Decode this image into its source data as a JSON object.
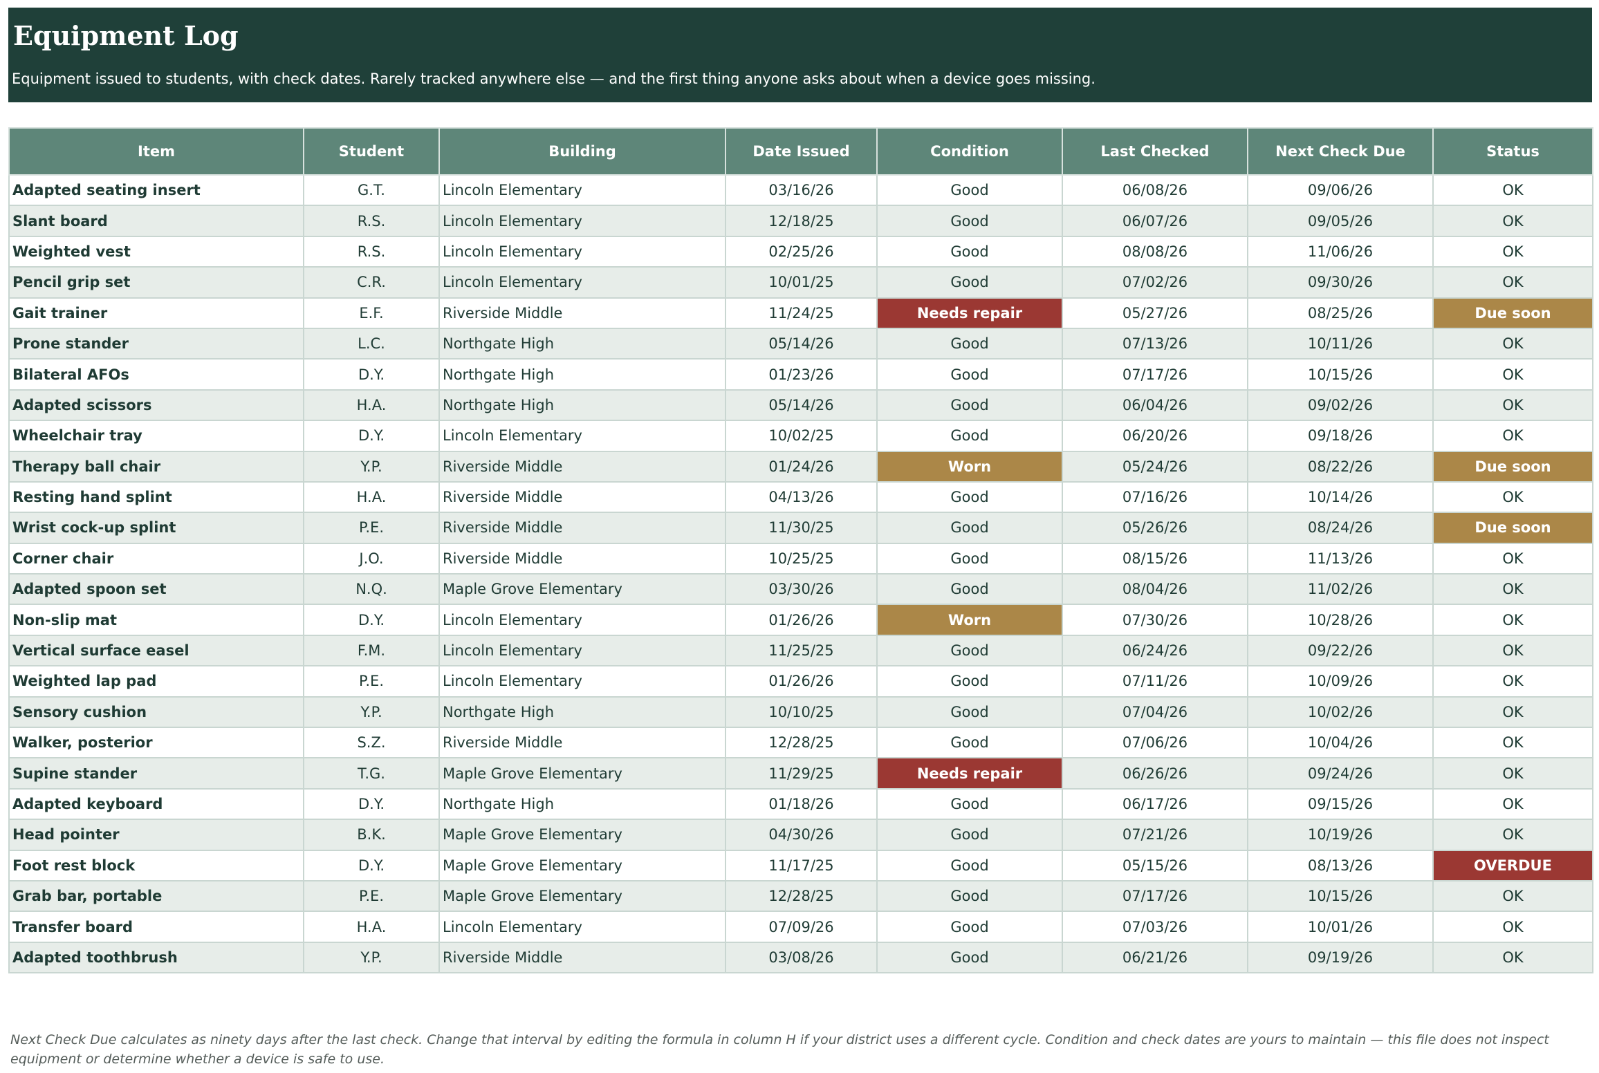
{
  "header": {
    "title": "Equipment Log",
    "subtitle": "Equipment issued to students, with check dates. Rarely tracked anywhere else — and the first thing anyone asks about when a device goes missing."
  },
  "table": {
    "columns": [
      "Item",
      "Student",
      "Building",
      "Date Issued",
      "Condition",
      "Last Checked",
      "Next Check Due",
      "Status"
    ],
    "rows": [
      [
        "Adapted seating insert",
        "G.T.",
        "Lincoln Elementary",
        "03/16/26",
        "Good",
        "06/08/26",
        "09/06/26",
        "OK"
      ],
      [
        "Slant board",
        "R.S.",
        "Lincoln Elementary",
        "12/18/25",
        "Good",
        "06/07/26",
        "09/05/26",
        "OK"
      ],
      [
        "Weighted vest",
        "R.S.",
        "Lincoln Elementary",
        "02/25/26",
        "Good",
        "08/08/26",
        "11/06/26",
        "OK"
      ],
      [
        "Pencil grip set",
        "C.R.",
        "Lincoln Elementary",
        "10/01/25",
        "Good",
        "07/02/26",
        "09/30/26",
        "OK"
      ],
      [
        "Gait trainer",
        "E.F.",
        "Riverside Middle",
        "11/24/25",
        "Needs repair",
        "05/27/26",
        "08/25/26",
        "Due soon"
      ],
      [
        "Prone stander",
        "L.C.",
        "Northgate High",
        "05/14/26",
        "Good",
        "07/13/26",
        "10/11/26",
        "OK"
      ],
      [
        "Bilateral AFOs",
        "D.Y.",
        "Northgate High",
        "01/23/26",
        "Good",
        "07/17/26",
        "10/15/26",
        "OK"
      ],
      [
        "Adapted scissors",
        "H.A.",
        "Northgate High",
        "05/14/26",
        "Good",
        "06/04/26",
        "09/02/26",
        "OK"
      ],
      [
        "Wheelchair tray",
        "D.Y.",
        "Lincoln Elementary",
        "10/02/25",
        "Good",
        "06/20/26",
        "09/18/26",
        "OK"
      ],
      [
        "Therapy ball chair",
        "Y.P.",
        "Riverside Middle",
        "01/24/26",
        "Worn",
        "05/24/26",
        "08/22/26",
        "Due soon"
      ],
      [
        "Resting hand splint",
        "H.A.",
        "Riverside Middle",
        "04/13/26",
        "Good",
        "07/16/26",
        "10/14/26",
        "OK"
      ],
      [
        "Wrist cock-up splint",
        "P.E.",
        "Riverside Middle",
        "11/30/25",
        "Good",
        "05/26/26",
        "08/24/26",
        "Due soon"
      ],
      [
        "Corner chair",
        "J.O.",
        "Riverside Middle",
        "10/25/25",
        "Good",
        "08/15/26",
        "11/13/26",
        "OK"
      ],
      [
        "Adapted spoon set",
        "N.Q.",
        "Maple Grove Elementary",
        "03/30/26",
        "Good",
        "08/04/26",
        "11/02/26",
        "OK"
      ],
      [
        "Non-slip mat",
        "D.Y.",
        "Lincoln Elementary",
        "01/26/26",
        "Worn",
        "07/30/26",
        "10/28/26",
        "OK"
      ],
      [
        "Vertical surface easel",
        "F.M.",
        "Lincoln Elementary",
        "11/25/25",
        "Good",
        "06/24/26",
        "09/22/26",
        "OK"
      ],
      [
        "Weighted lap pad",
        "P.E.",
        "Lincoln Elementary",
        "01/26/26",
        "Good",
        "07/11/26",
        "10/09/26",
        "OK"
      ],
      [
        "Sensory cushion",
        "Y.P.",
        "Northgate High",
        "10/10/25",
        "Good",
        "07/04/26",
        "10/02/26",
        "OK"
      ],
      [
        "Walker, posterior",
        "S.Z.",
        "Riverside Middle",
        "12/28/25",
        "Good",
        "07/06/26",
        "10/04/26",
        "OK"
      ],
      [
        "Supine stander",
        "T.G.",
        "Maple Grove Elementary",
        "11/29/25",
        "Needs repair",
        "06/26/26",
        "09/24/26",
        "OK"
      ],
      [
        "Adapted keyboard",
        "D.Y.",
        "Northgate High",
        "01/18/26",
        "Good",
        "06/17/26",
        "09/15/26",
        "OK"
      ],
      [
        "Head pointer",
        "B.K.",
        "Maple Grove Elementary",
        "04/30/26",
        "Good",
        "07/21/26",
        "10/19/26",
        "OK"
      ],
      [
        "Foot rest block",
        "D.Y.",
        "Maple Grove Elementary",
        "11/17/25",
        "Good",
        "05/15/26",
        "08/13/26",
        "OVERDUE"
      ],
      [
        "Grab bar, portable",
        "P.E.",
        "Maple Grove Elementary",
        "12/28/25",
        "Good",
        "07/17/26",
        "10/15/26",
        "OK"
      ],
      [
        "Transfer board",
        "H.A.",
        "Lincoln Elementary",
        "07/09/26",
        "Good",
        "07/03/26",
        "10/01/26",
        "OK"
      ],
      [
        "Adapted toothbrush",
        "Y.P.",
        "Riverside Middle",
        "03/08/26",
        "Good",
        "06/21/26",
        "09/19/26",
        "OK"
      ]
    ]
  },
  "highlight_colors": {
    "Needs repair": "#9b3833",
    "Worn": "#ab8748",
    "Due soon": "#ab8748",
    "OVERDUE": "#9b3833"
  },
  "footnote": "Next Check Due calculates as ninety days after the last check. Change that interval by editing the formula in column H if your district uses a different cycle. Condition and check dates are yours to maintain — this file does not inspect equipment or determine whether a device is safe to use."
}
